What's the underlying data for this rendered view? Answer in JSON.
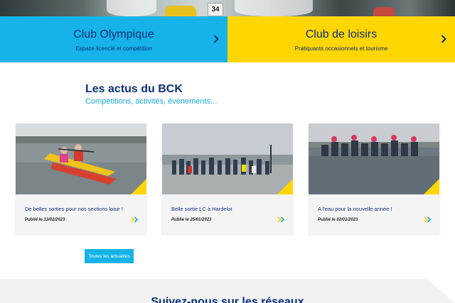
{
  "hero": {
    "bib_number": "34"
  },
  "clubs": [
    {
      "title": "Club Olympique",
      "subtitle": "Espace licencié et compétition"
    },
    {
      "title": "Club de loisirs",
      "subtitle": "Pratiquants occasionnels et tourisme"
    }
  ],
  "news": {
    "title": "Les actus du BCK",
    "subtitle": "Compétitions, activités, événements...",
    "cards": [
      {
        "headline": "De belles sorties pour nos sections loisir !",
        "date": "Publié le 13/02/2023"
      },
      {
        "headline": "Belle sortie LC à Hardelot",
        "date": "Publié le 25/01/2023"
      },
      {
        "headline": "A l'eau pour la nouvelle année !",
        "date": "Publié le 02/01/2023"
      }
    ],
    "all_button": "Toutes les actualités"
  },
  "social": {
    "title": "Suivez-nous sur les réseaux"
  },
  "colors": {
    "navy": "#0c2f7a",
    "cyan": "#16b3e8",
    "yellow": "#ffd600"
  },
  "icons": {
    "club_arrow": "chevron-right-icon",
    "card_arrow": "double-chevron-right-icon"
  }
}
